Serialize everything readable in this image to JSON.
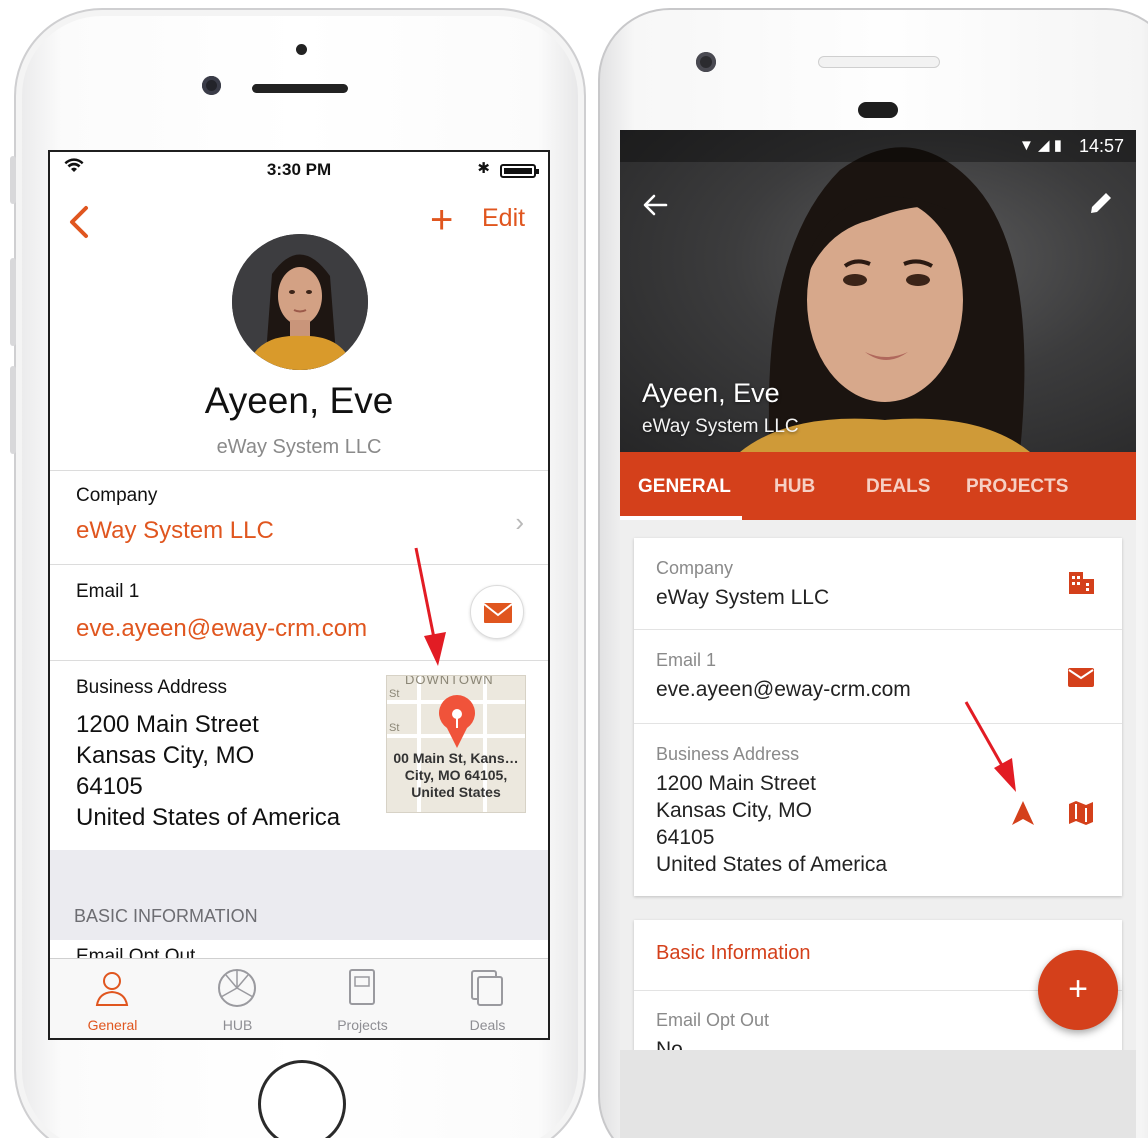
{
  "ios": {
    "status": {
      "time": "3:30 PM"
    },
    "header": {
      "edit_label": "Edit",
      "plus_label": "+"
    },
    "contact": {
      "name": "Ayeen, Eve",
      "company": "eWay System LLC"
    },
    "company_row": {
      "label": "Company",
      "value": "eWay System LLC"
    },
    "email_row": {
      "label": "Email 1",
      "value": "eve.ayeen@eway-crm.com"
    },
    "address_row": {
      "label": "Business Address",
      "lines": [
        "1200 Main Street",
        "Kansas City, MO",
        "64105",
        "United States of America"
      ],
      "map_text": [
        "00 Main St, Kans…",
        "City, MO  64105,",
        "United States"
      ],
      "map_downtown": "DOWNTOWN",
      "map_street_abbr": "St"
    },
    "section": {
      "label": "BASIC INFORMATION",
      "peek": "Email Opt Out"
    },
    "tabbar": {
      "tabs": [
        {
          "label": "General",
          "icon": "person-icon",
          "active": true
        },
        {
          "label": "HUB",
          "icon": "hub-icon",
          "active": false
        },
        {
          "label": "Projects",
          "icon": "projects-icon",
          "active": false
        },
        {
          "label": "Deals",
          "icon": "deals-icon",
          "active": false
        }
      ]
    }
  },
  "android": {
    "status": {
      "time": "14:57"
    },
    "contact": {
      "name": "Ayeen, Eve",
      "company": "eWay System LLC"
    },
    "tabs": [
      {
        "label": "GENERAL",
        "active": true
      },
      {
        "label": "HUB",
        "active": false
      },
      {
        "label": "DEALS",
        "active": false
      },
      {
        "label": "PROJECTS",
        "active": false
      }
    ],
    "fields": {
      "company": {
        "label": "Company",
        "value": "eWay System LLC"
      },
      "email": {
        "label": "Email 1",
        "value": "eve.ayeen@eway-crm.com"
      },
      "address": {
        "label": "Business Address",
        "lines": [
          "1200 Main Street",
          "Kansas City, MO",
          "64105",
          "United States of America"
        ]
      }
    },
    "basic_info": {
      "title": "Basic Information",
      "field_label": "Email Opt Out",
      "field_value_peek": "No"
    },
    "fab_label": "+"
  },
  "colors": {
    "ios_accent": "#e0561f",
    "android_accent": "#d4401b",
    "arrow": "#e21c24"
  }
}
